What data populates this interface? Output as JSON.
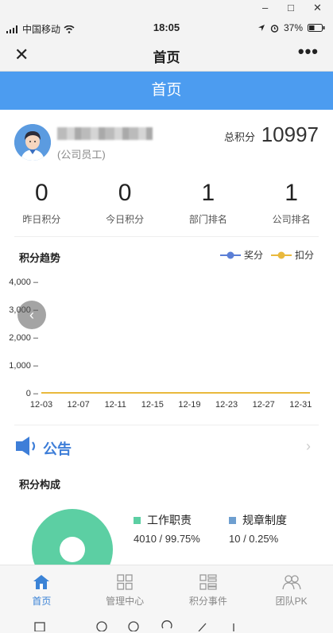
{
  "window": {
    "minimize": "–",
    "maximize": "□",
    "close": "✕"
  },
  "status": {
    "carrier": "中国移动",
    "time": "18:05",
    "battery": "37%"
  },
  "nav": {
    "title": "首页",
    "close_icon": "close-icon",
    "more_icon": "more-icon"
  },
  "header": {
    "title": "首页"
  },
  "profile": {
    "role": "(公司员工)",
    "total_label": "总积分",
    "total_value": "10997"
  },
  "stats": [
    {
      "value": "0",
      "label": "昨日积分"
    },
    {
      "value": "0",
      "label": "今日积分"
    },
    {
      "value": "1",
      "label": "部门排名"
    },
    {
      "value": "1",
      "label": "公司排名"
    }
  ],
  "trend": {
    "title": "积分趋势",
    "legend": [
      {
        "name": "奖分",
        "color": "#5b7fd6"
      },
      {
        "name": "扣分",
        "color": "#e9b93d"
      }
    ]
  },
  "chart_data": {
    "type": "line",
    "title": "积分趋势",
    "x": [
      "12-03",
      "12-04",
      "12-05",
      "12-06",
      "12-07",
      "12-08",
      "12-09",
      "12-10",
      "12-11",
      "12-12",
      "12-13",
      "12-14",
      "12-15",
      "12-16",
      "12-17",
      "12-18",
      "12-19",
      "12-20",
      "12-21",
      "12-22",
      "12-23",
      "12-24",
      "12-25",
      "12-26",
      "12-27",
      "12-28",
      "12-29",
      "12-30",
      "12-31",
      "01-01"
    ],
    "x_tick_labels": [
      "12-03",
      "12-07",
      "12-11",
      "12-15",
      "12-19",
      "12-23",
      "12-27",
      "12-31"
    ],
    "y_tick_labels": [
      "0",
      "1,000",
      "2,000",
      "3,000",
      "4,000"
    ],
    "ylim": [
      0,
      4000
    ],
    "series": [
      {
        "name": "奖分",
        "color": "#5b7fd6",
        "area": true,
        "values": [
          0,
          0,
          0,
          0,
          0,
          0,
          0,
          0,
          0,
          0,
          0,
          0,
          0,
          0,
          0,
          0,
          0,
          0,
          0,
          0,
          0,
          0,
          0,
          0,
          0,
          0,
          0,
          0,
          0,
          0
        ]
      },
      {
        "name": "扣分",
        "color": "#e9b93d",
        "values": [
          0,
          0,
          0,
          0,
          0,
          0,
          0,
          0,
          0,
          0,
          0,
          0,
          0,
          0,
          0,
          0,
          0,
          0,
          0,
          0,
          0,
          0,
          0,
          0,
          0,
          0,
          0,
          0,
          0,
          0
        ]
      }
    ]
  },
  "notice": {
    "label": "公告"
  },
  "composition": {
    "title": "积分构成",
    "items": [
      {
        "name": "工作职责",
        "value": "4010 / 99.75%",
        "color": "#5ccfa3"
      },
      {
        "name": "规章制度",
        "value": "10 / 0.25%",
        "color": "#6e9fd0"
      }
    ]
  },
  "tabs": [
    {
      "label": "首页",
      "icon": "home-icon",
      "active": true
    },
    {
      "label": "管理中心",
      "icon": "grid-icon",
      "active": false
    },
    {
      "label": "积分事件",
      "icon": "list-icon",
      "active": false
    },
    {
      "label": "团队PK",
      "icon": "team-icon",
      "active": false
    }
  ]
}
